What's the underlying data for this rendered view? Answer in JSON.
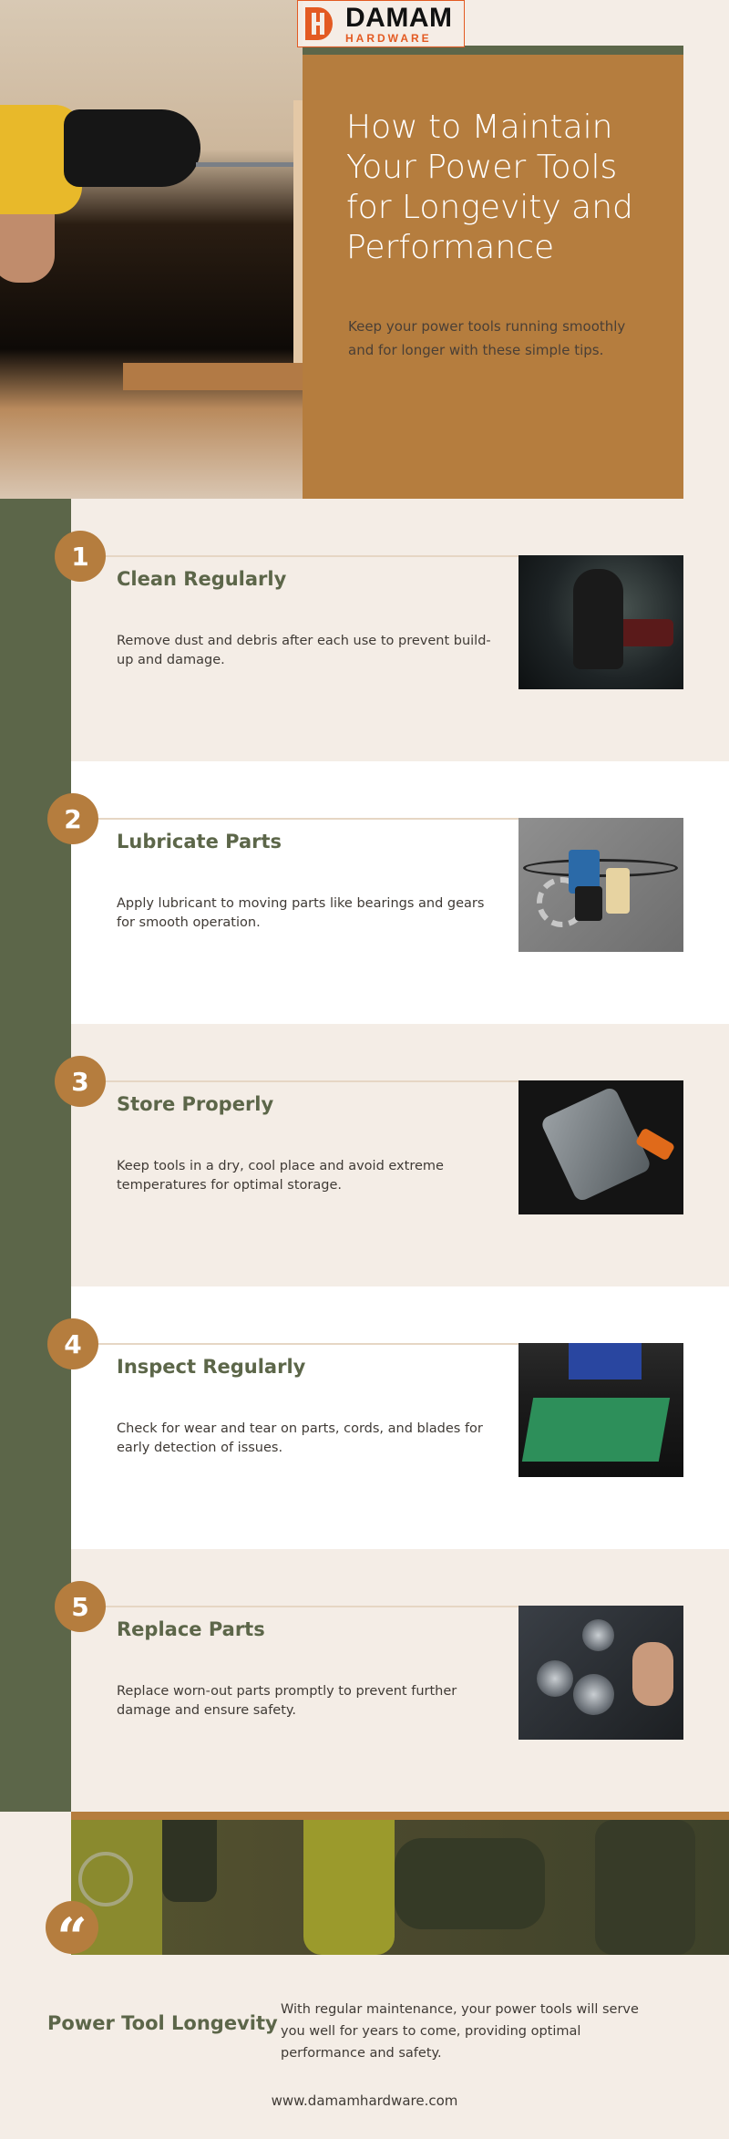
{
  "brand": {
    "name": "DAMAM",
    "tagline": "HARDWARE",
    "colors": {
      "green": "#5c6649",
      "ochre": "#b57d3e",
      "cream": "#f4ede6",
      "logo_orange": "#e35a22"
    }
  },
  "hero": {
    "title": "How to Maintain Your Power Tools for Longevity and Performance",
    "subtitle": "Keep your power tools running smoothly and for longer with these simple tips.",
    "image_alt": "drill-photo"
  },
  "steps": [
    {
      "number": "1",
      "title": "Clean Regularly",
      "description": "Remove dust and debris after each use to prevent build-up and damage.",
      "image": "mechanic-workshop-photo"
    },
    {
      "number": "2",
      "title": "Lubricate Parts",
      "description": "Apply lubricant to moving parts like bearings and gears for smooth operation.",
      "image": "engine-parts-photo"
    },
    {
      "number": "3",
      "title": "Store Properly",
      "description": "Keep tools in a dry, cool place and avoid extreme temperatures for optimal storage.",
      "image": "multitool-photo"
    },
    {
      "number": "4",
      "title": "Inspect Regularly",
      "description": "Check for wear and tear on parts, cords, and blades for early detection of issues.",
      "image": "toolbox-inspection-photo"
    },
    {
      "number": "5",
      "title": "Replace Parts",
      "description": "Replace worn-out parts promptly to prevent further damage and ensure safety.",
      "image": "part-replacement-photo"
    }
  ],
  "closing": {
    "quote_mark": "“",
    "title": "Power Tool Longevity",
    "text": "With regular maintenance, your power tools will serve you well for years to come, providing optimal performance and safety.",
    "website": "www.damamhardware.com"
  }
}
